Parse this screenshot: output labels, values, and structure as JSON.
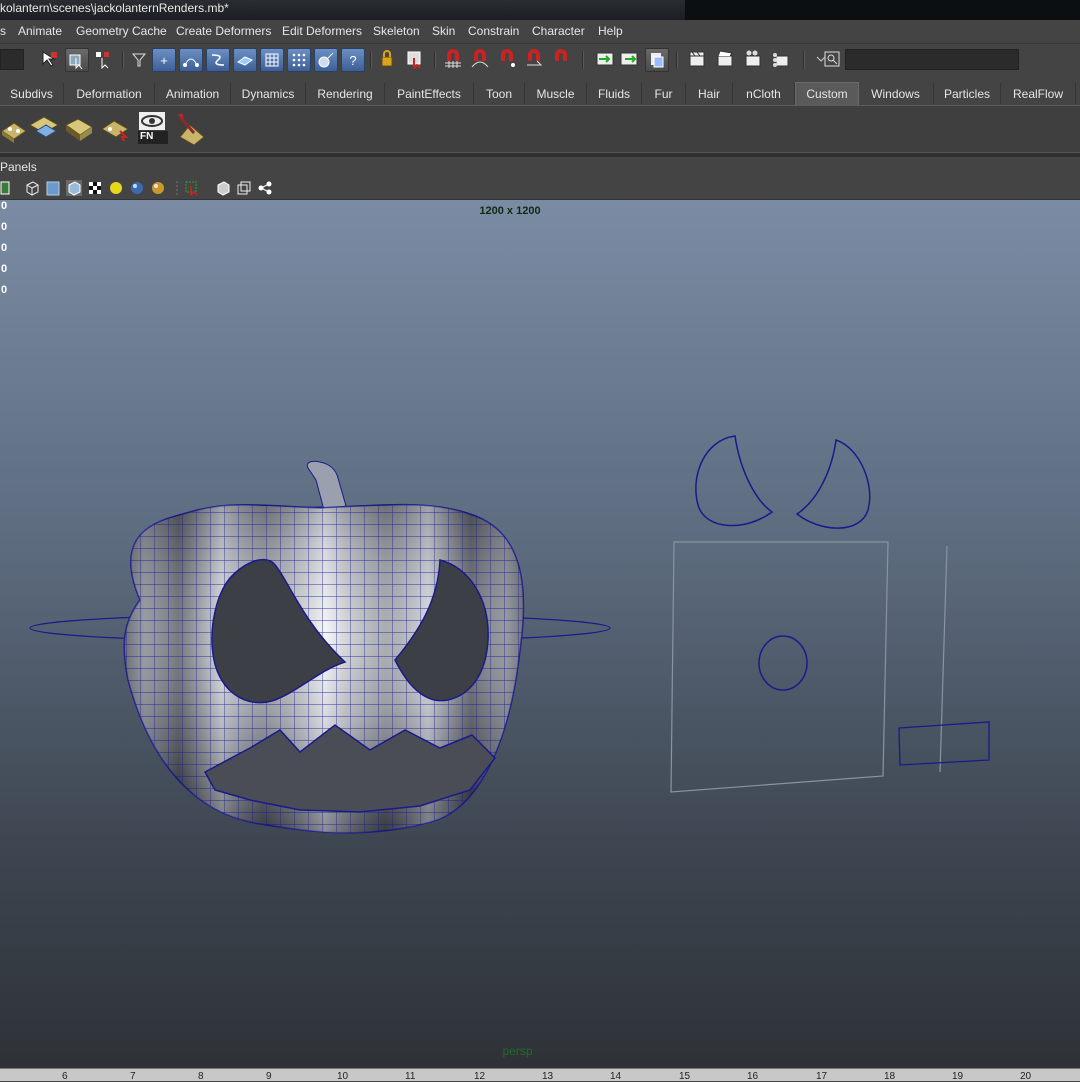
{
  "window": {
    "title": "kolantern\\scenes\\jackolanternRenders.mb*"
  },
  "menu": [
    "s",
    "Animate",
    "Geometry Cache",
    "Create Deformers",
    "Edit Deformers",
    "Skeleton",
    "Skin",
    "Constrain",
    "Character",
    "Help"
  ],
  "toolbar": {
    "icons": [
      "select-by-hierarchy-icon",
      "select-by-object-icon",
      "select-by-component-icon",
      "filter-icon",
      "move-icon",
      "curve-cv-icon",
      "curve-icon",
      "surface-icon",
      "lattice-icon",
      "points-icon",
      "deformer-icon",
      "help-icon",
      "lock-icon",
      "selection-mask-icon",
      "snap-grid-icon",
      "snap-curve-icon",
      "snap-point-icon",
      "snap-view-icon",
      "snap-live-icon",
      "input-icon",
      "output-icon",
      "construction-history-icon",
      "render-icon",
      "ipr-render-icon",
      "render-settings-icon",
      "hypershade-icon",
      "numeric-input-icon"
    ]
  },
  "shelf_tabs": [
    "Subdivs",
    "Deformation",
    "Animation",
    "Dynamics",
    "Rendering",
    "PaintEffects",
    "Toon",
    "Muscle",
    "Fluids",
    "Fur",
    "Hair",
    "nCloth",
    "Custom",
    "Windows",
    "Particles",
    "RealFlow"
  ],
  "active_tab": "Custom",
  "shelf_items": [
    "texture-tool-1-icon",
    "texture-tool-2-icon",
    "book-icon",
    "texture-tool-3-icon",
    "eye-fn-icon",
    "paint-tool-icon"
  ],
  "shelf_fn_label": "FN",
  "panel": {
    "menu_label": "Panels"
  },
  "panel_tools": [
    "wireframe-icon",
    "smooth-shade-icon",
    "smooth-shade-all-icon",
    "textured-icon",
    "checker-icon",
    "default-light-icon",
    "all-lights-icon",
    "shadows-icon",
    "isolate-select-icon",
    "xray-icon",
    "backface-icon",
    "hypergraph-icon"
  ],
  "viewport": {
    "resolution_gate": "1200 x 1200",
    "hud_values": [
      "0",
      "0",
      "0",
      "0",
      "0"
    ],
    "camera": "persp"
  },
  "timeline": {
    "ticks": [
      "6",
      "7",
      "8",
      "9",
      "10",
      "11",
      "12",
      "13",
      "14",
      "15",
      "16",
      "17",
      "18",
      "19",
      "20"
    ]
  },
  "colors": {
    "viewport_top": "#7a8ca4",
    "viewport_bottom": "#2e3237",
    "wireframe": "#1a1a8c",
    "active_tab": "#5a5a5a"
  }
}
